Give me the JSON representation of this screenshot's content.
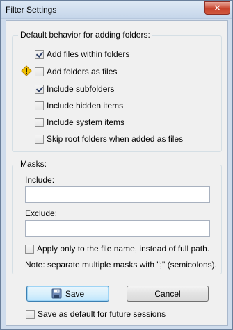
{
  "window": {
    "title": "Filter Settings",
    "close_glyph": "✕"
  },
  "behavior_group": {
    "title": "Default behavior for adding folders:",
    "options": [
      {
        "label": "Add files within folders",
        "checked": true
      },
      {
        "label": "Add folders as files",
        "checked": false,
        "warning": "warning-icon"
      },
      {
        "label": "Include subfolders",
        "checked": true
      },
      {
        "label": "Include hidden items",
        "checked": false
      },
      {
        "label": "Include system items",
        "checked": false
      },
      {
        "label": "Skip root folders when added as files",
        "checked": false
      }
    ]
  },
  "masks_group": {
    "title": "Masks:",
    "include_label": "Include:",
    "include_value": "",
    "exclude_label": "Exclude:",
    "exclude_value": "",
    "apply_filename_label": "Apply only to the file name, instead of full path.",
    "apply_filename_checked": false,
    "note": "Note: separate multiple masks with \";\" (semicolons)."
  },
  "buttons": {
    "save": "Save",
    "cancel": "Cancel",
    "save_icon": "floppy-disk-icon"
  },
  "footer": {
    "save_default_label": "Save as default for future sessions",
    "save_default_checked": false
  },
  "colors": {
    "warning": "#f2c100",
    "default_button_border": "#3c7fb1",
    "close_button": "#c7432c"
  }
}
